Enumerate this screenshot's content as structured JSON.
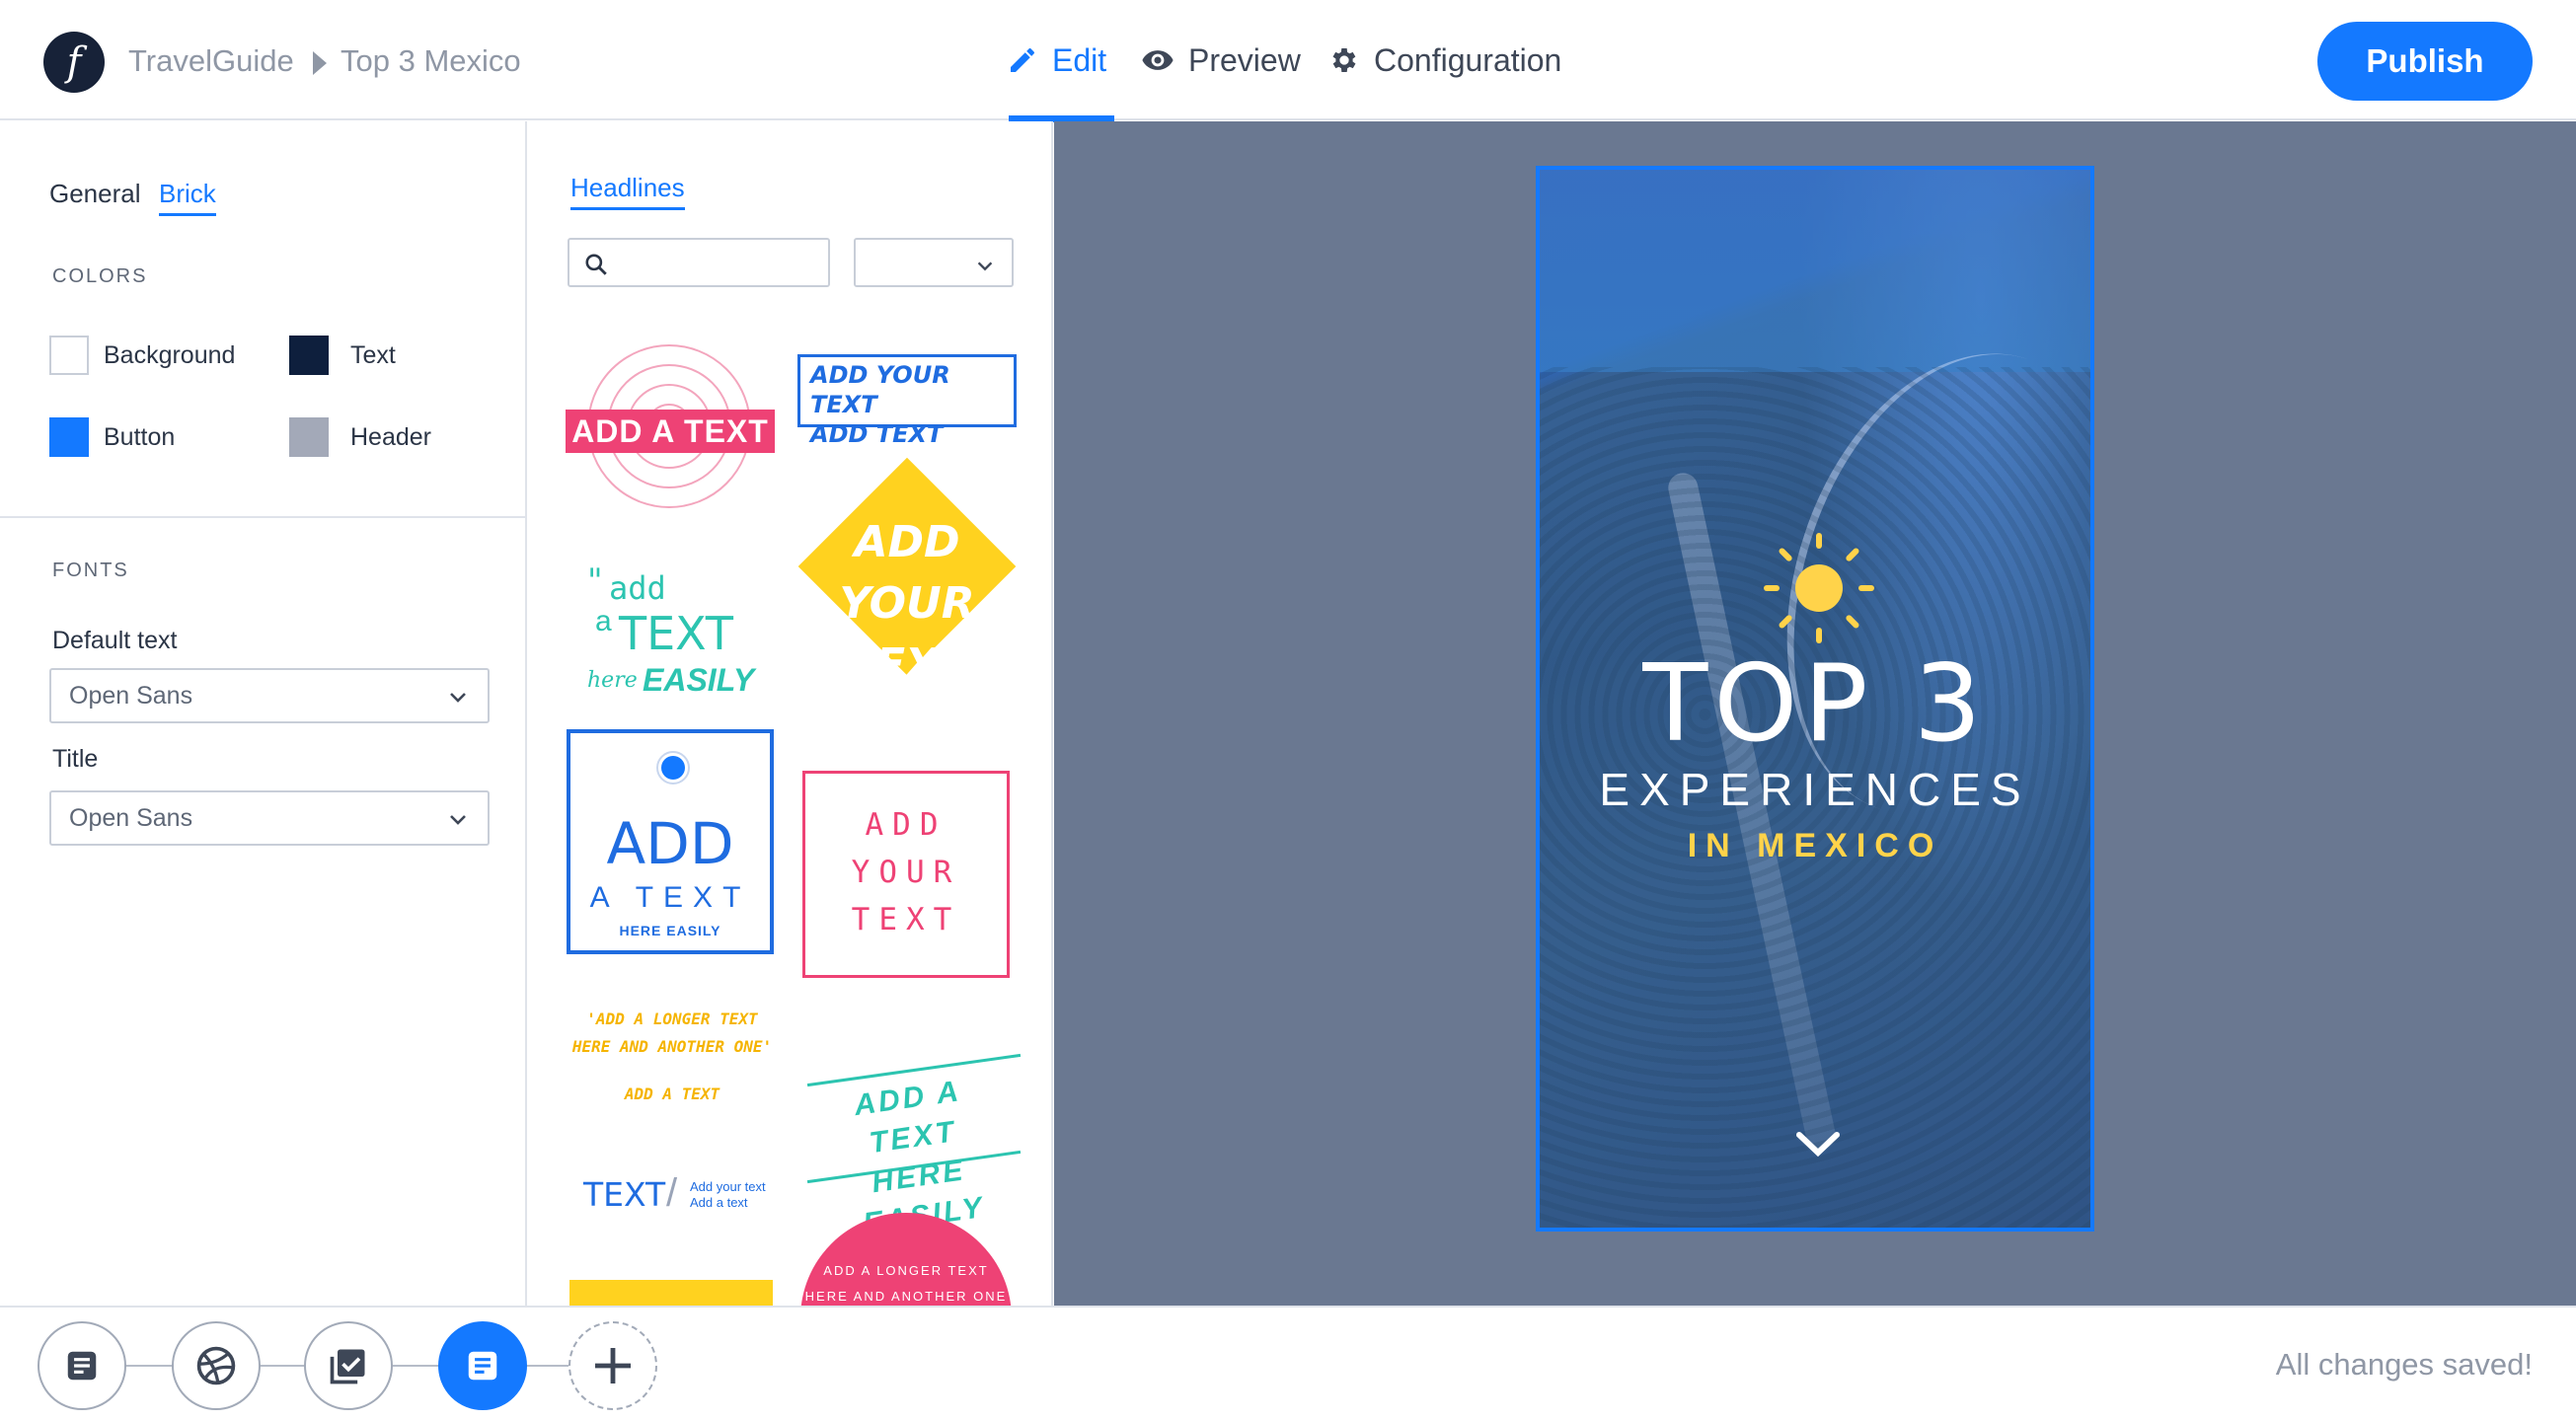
{
  "header": {
    "logo_letter": "f",
    "breadcrumb": [
      "TravelGuide",
      "Top 3 Mexico"
    ],
    "tabs": [
      {
        "label": "Edit",
        "icon": "pencil-icon",
        "active": true
      },
      {
        "label": "Preview",
        "icon": "eye-icon",
        "active": false
      },
      {
        "label": "Configuration",
        "icon": "gear-icon",
        "active": false
      }
    ],
    "publish_label": "Publish"
  },
  "left_panel": {
    "tabs": [
      "General",
      "Brick"
    ],
    "active_tab": "Brick",
    "colors_title": "COLORS",
    "colors": [
      {
        "label": "Background",
        "value": "#ffffff"
      },
      {
        "label": "Text",
        "value": "#0e1f3d"
      },
      {
        "label": "Button",
        "value": "#1479ff"
      },
      {
        "label": "Header",
        "value": "#a3a9b8"
      }
    ],
    "fonts_title": "FONTS",
    "fonts": [
      {
        "label": "Default text",
        "value": "Open Sans"
      },
      {
        "label": "Title",
        "value": "Open Sans"
      }
    ]
  },
  "library": {
    "tab": "Headlines",
    "search_placeholder": "",
    "filter_value": "",
    "tiles": {
      "t1": "ADD A TEXT",
      "t2": [
        "ADD YOUR TEXT",
        "ADD TEXT"
      ],
      "t3": {
        "quote": "\"",
        "add": "add",
        "a": "a",
        "text": "TEXT",
        "here": "here",
        "easily": "EASILY"
      },
      "t4": [
        "ADD",
        "YOUR",
        "TEXT"
      ],
      "t5": {
        "add": "ADD",
        "atext": "A TEXT",
        "here": "HERE EASILY"
      },
      "t6": [
        "ADD",
        "YOUR",
        "TEXT"
      ],
      "t7": [
        "'ADD A LONGER TEXT",
        "HERE AND ANOTHER ONE'",
        "ADD A TEXT"
      ],
      "t8": [
        "ADD A TEXT",
        "HERE EASILY"
      ],
      "t9": {
        "big": "TEXT",
        "slash": "/",
        "small": [
          "Add your text",
          "Add a text"
        ]
      },
      "t11": [
        "ADD A LONGER TEXT",
        "HERE AND ANOTHER ONE"
      ]
    }
  },
  "story": {
    "title_top": "TOP 3",
    "title_mid": "EXPERIENCES",
    "title_bot": "IN MEXICO",
    "accent": "#ffd34a"
  },
  "bottombar": {
    "steps": [
      {
        "icon": "document-icon",
        "active": false
      },
      {
        "icon": "dribbble-icon",
        "active": false
      },
      {
        "icon": "checklist-icon",
        "active": false
      },
      {
        "icon": "document-icon",
        "active": true
      },
      {
        "icon": "plus-icon",
        "active": false
      }
    ],
    "status": "All changes saved!"
  }
}
